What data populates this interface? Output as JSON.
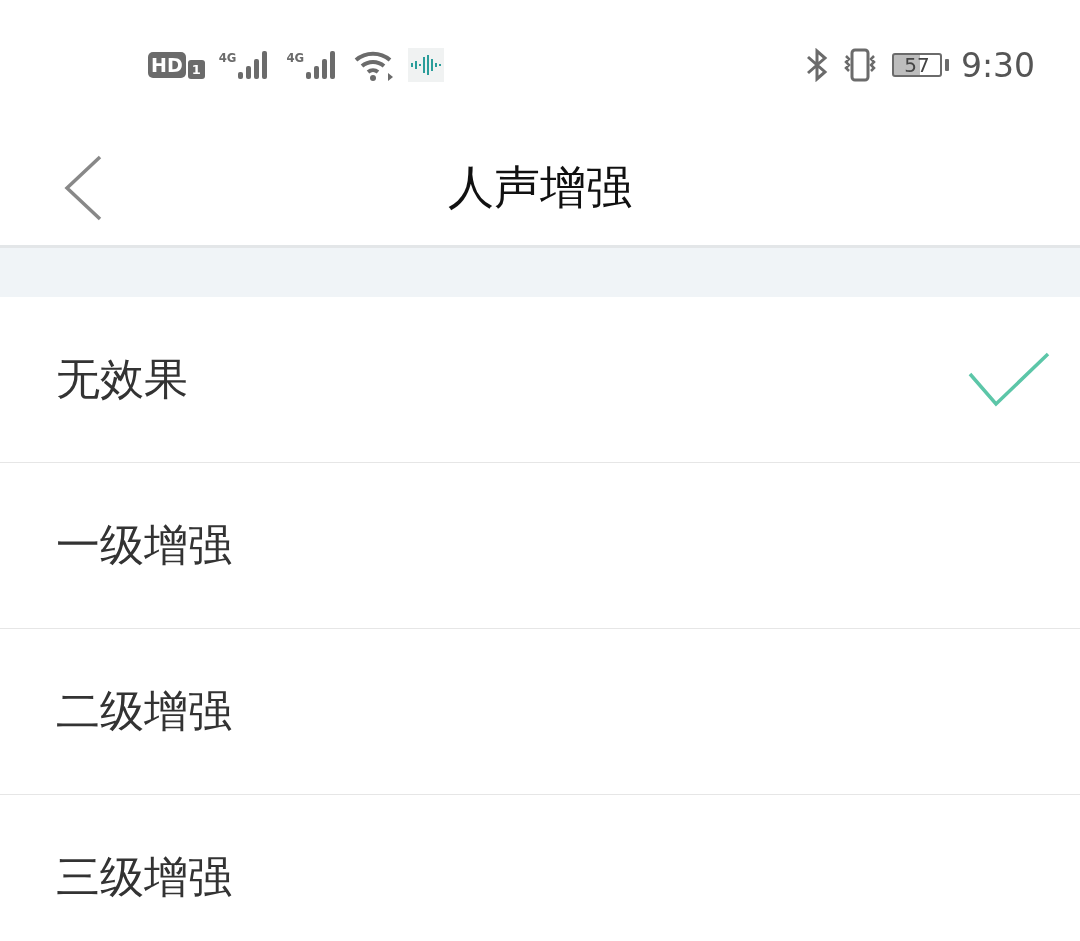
{
  "status_bar": {
    "hd_badge": "HD",
    "sim_number": "1",
    "networks": [
      "4G",
      "4G"
    ],
    "battery": "57",
    "time": "9:30"
  },
  "header": {
    "title": "人声增强"
  },
  "options": [
    {
      "label": "无效果",
      "selected": true
    },
    {
      "label": "一级增强",
      "selected": false
    },
    {
      "label": "二级增强",
      "selected": false
    },
    {
      "label": "三级增强",
      "selected": false
    }
  ]
}
